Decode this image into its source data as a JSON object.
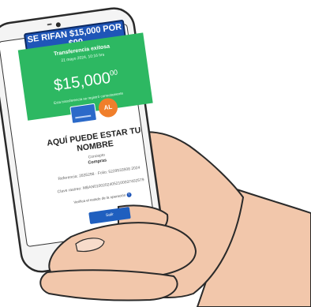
{
  "banner": {
    "text": "SE RIFAN $15,000 POR $99"
  },
  "transfer": {
    "status": "Transferencia exitosa",
    "date": "21 mayo 2024, 10:16 hrs",
    "amount_main": "$15,000",
    "amount_cents": "00",
    "note": "Esta transferencia se registró correctamente"
  },
  "avatar": {
    "initials": "AL"
  },
  "recipient": {
    "title": "AQUÍ PUEDE ESTAR TU NOMBRE"
  },
  "details": {
    "concept_label": "Concepto",
    "concept_value": "Compras",
    "reference": "Referencia: 2835298 · Folio: 5229533508 2024",
    "tracking": "Clave rastreo: MBAN01002024052100037402579",
    "verify_link": "Verifica el estado de la operación"
  },
  "button": {
    "label": "Salir"
  },
  "colors": {
    "banner": "#1f56b8",
    "success_green": "#2db862",
    "avatar": "#f07f2b",
    "button": "#1f5fbf",
    "skin": "#f2c7ab",
    "phone_body": "#f4f4f4"
  },
  "icons": [
    "card-icon",
    "help-icon"
  ]
}
